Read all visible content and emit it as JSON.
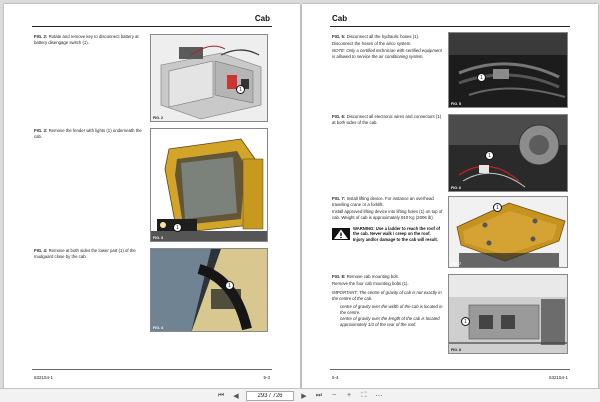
{
  "left": {
    "header": "Cab",
    "steps": [
      {
        "label": "FIG. 2:",
        "text": "Rotate and remove key to disconnect battery at battery disengage switch (1)."
      },
      {
        "label": "FIG. 3:",
        "text": "Remove the fender with lights (1) underneath the cab."
      },
      {
        "label": "FIG. 4:",
        "text": "Remove at both sides the lower part (1) of the mudguard close by the cab."
      }
    ],
    "figs": [
      "FIG. 2",
      "FIG. 3",
      "FIG. 4"
    ],
    "footer_left": "632154-1",
    "footer_right": "5-3"
  },
  "right": {
    "header": "Cab",
    "steps": [
      {
        "label": "FIG. 5:",
        "text": "Disconnect all the hydraulic hoses (1)."
      },
      {
        "text": "Disconnect the hoses of the airco system."
      },
      {
        "label": "NOTE:",
        "text": "Only a certified technician with certified equipment is allowed to service the air conditioning system."
      },
      {
        "label": "FIG. 6:",
        "text": "Disconnect all electronic wires and connectors (1) at both sides of the cab."
      },
      {
        "label": "FIG. 7:",
        "text": "Install lifting device. For instance an overhead travelling crane or a forklift."
      },
      {
        "text": "Install approved lifting device into lifting holes (1) on top of cab. Weight of cab is approximately 910 Kg (2006 lb)."
      },
      {
        "label": "FIG. 8:",
        "text": "Remove cab mounting bolt."
      },
      {
        "text": "Remove the four cab mounting bolts (1)."
      },
      {
        "label": "IMPORTANT:",
        "text": "The centre of gravity of cab is not exactly in the centre of the cab."
      },
      {
        "text": "centre of gravity over the width of the cab is located in the centre."
      },
      {
        "text": "centre of gravity over the length of the cab is located approximately 1/3 of the rear of the roof."
      }
    ],
    "warning": "WARNING: Use a ladder to reach the roof of the cab. Never walk / creep on the roof. Injury and/or damage to the cab will result.",
    "figs": [
      "FIG. 5",
      "FIG. 6",
      "FIG. 7",
      "FIG. 8"
    ],
    "footer_left": "5-4",
    "footer_right": "632154-1"
  },
  "toolbar": {
    "page_value": "293 / 726"
  },
  "callout_label": "1"
}
